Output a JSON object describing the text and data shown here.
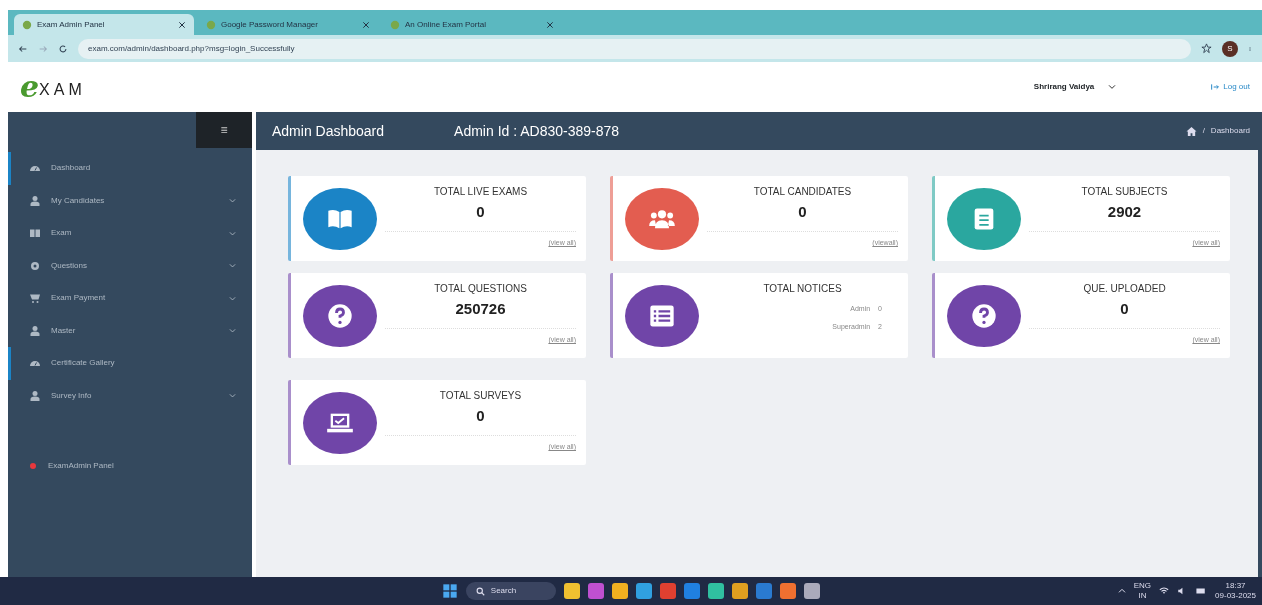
{
  "browser": {
    "tabs": [
      {
        "label": "Exam Admin Panel",
        "selected": true
      },
      {
        "label": "Google Password Manager",
        "selected": false
      },
      {
        "label": "An Online Exam Portal",
        "selected": false
      }
    ],
    "url": "exam.com/admin/dashboard.php?msg=login_Successfully",
    "profile": "S"
  },
  "header": {
    "logo_letter": "e",
    "logo_text": "XAM",
    "user": "Shrirang Vaidya",
    "logout": "Log out"
  },
  "sidebar": {
    "menu_glyph": "≡",
    "items": [
      {
        "label": "Dashboard",
        "kind": "gauge",
        "expandable": false,
        "selected": true
      },
      {
        "label": "My Candidates",
        "kind": "person",
        "expandable": true,
        "selected": false
      },
      {
        "label": "Exam",
        "kind": "book",
        "expandable": true,
        "selected": false
      },
      {
        "label": "Questions",
        "kind": "gear",
        "expandable": true,
        "selected": false
      },
      {
        "label": "Exam Payment",
        "kind": "cart",
        "expandable": true,
        "selected": false
      },
      {
        "label": "Master",
        "kind": "person",
        "expandable": true,
        "selected": false
      },
      {
        "label": "Certificate Gallery",
        "kind": "gauge",
        "expandable": false,
        "selected": true
      },
      {
        "label": "Survey Info",
        "kind": "person",
        "expandable": true,
        "selected": false
      }
    ],
    "footer": "ExamAdmin Panel"
  },
  "topbar": {
    "title": "Admin Dashboard",
    "admin_id": "Admin Id : AD830-389-878",
    "breadcrumb_separator": "/",
    "breadcrumb": "Dashboard"
  },
  "cards": [
    {
      "title": "TOTAL LIVE EXAMS",
      "value": "0",
      "link": "(view all)",
      "kind": "book",
      "color": "#1b84c6"
    },
    {
      "title": "TOTAL CANDIDATES",
      "value": "0",
      "link": "(viewall)",
      "kind": "users",
      "color": "#e35d50"
    },
    {
      "title": "TOTAL SUBJECTS",
      "value": "2902",
      "link": "(view all)",
      "kind": "document",
      "color": "#2aa79f"
    },
    {
      "title": "TOTAL QUESTIONS",
      "value": "250726",
      "link": "(view all)",
      "kind": "question",
      "color": "#7045a8"
    },
    {
      "title": "TOTAL NOTICES",
      "rows": [
        {
          "label": "Admin",
          "value": "0"
        },
        {
          "label": "Superadmin",
          "value": "2"
        }
      ],
      "kind": "list",
      "color": "#7045a8"
    },
    {
      "title": "QUE. UPLOADED",
      "value": "0",
      "link": "(view all)",
      "kind": "question",
      "color": "#7045a8"
    },
    {
      "title": "TOTAL SURVEYS",
      "value": "0",
      "link": "(view all)",
      "kind": "laptop",
      "color": "#7045a8"
    }
  ],
  "taskbar": {
    "search": "Search",
    "lang": "ENG",
    "region": "IN",
    "time": "18:37",
    "date": "09-03-2025"
  }
}
